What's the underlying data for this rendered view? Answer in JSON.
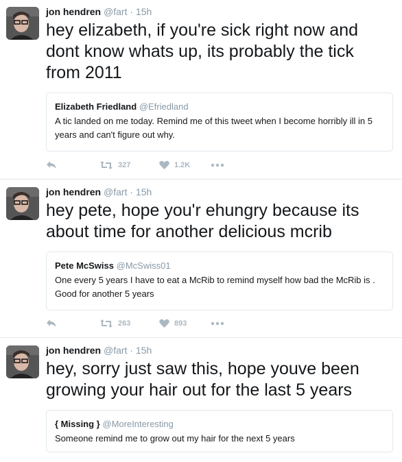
{
  "colors": {
    "text": "#14171a",
    "muted": "#8899a6",
    "action": "#aab8c2",
    "border": "#e1e8ed"
  },
  "tweets": [
    {
      "name": "jon hendren",
      "handle": "@fart",
      "time": "· 15h",
      "text": "hey elizabeth, if you're sick right now and dont know whats up, its probably the tick from 2011",
      "quote": {
        "name": "Elizabeth Friedland",
        "handle": "@Efriedland",
        "text": "A tic landed on me today. Remind me of this tweet when I become horribly ill in 5 years and can't figure out why."
      },
      "retweets": "327",
      "likes": "1.2K"
    },
    {
      "name": "jon hendren",
      "handle": "@fart",
      "time": "· 15h",
      "text": "hey pete, hope you'r ehungry because its about time for another delicious mcrib",
      "quote": {
        "name": "Pete McSwiss",
        "handle": "@McSwiss01",
        "text": "One every 5 years I have to eat a McRib to remind myself how bad the McRib is . Good for another 5 years"
      },
      "retweets": "263",
      "likes": "893"
    },
    {
      "name": "jon hendren",
      "handle": "@fart",
      "time": "· 15h",
      "text": "hey, sorry just saw this, hope youve been growing your hair out for the last 5 years",
      "quote": {
        "name": "{ Missing }",
        "handle": "@MoreInteresting",
        "text": "Someone remind me to grow out my hair for the next 5 years"
      }
    }
  ]
}
